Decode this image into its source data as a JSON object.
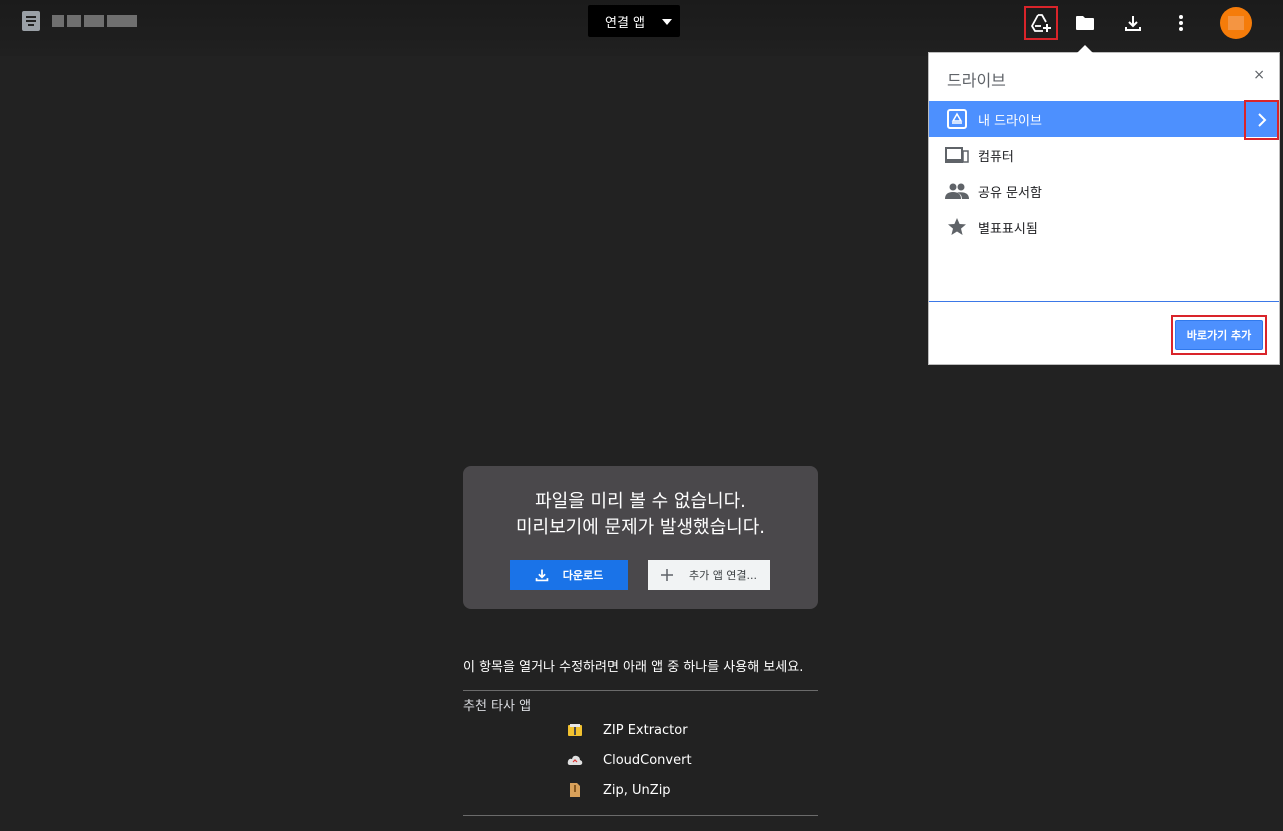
{
  "header": {
    "open_app_label": "연결 앱",
    "icons": [
      "add-shortcut-to-drive-icon",
      "folder-icon",
      "download-icon",
      "more-vert-icon"
    ]
  },
  "drive_panel": {
    "title": "드라이브",
    "close_label": "×",
    "items": [
      {
        "label": "내 드라이브",
        "icon": "my-drive-icon",
        "active": true
      },
      {
        "label": "컴퓨터",
        "icon": "computers-icon",
        "active": false
      },
      {
        "label": "공유 문서함",
        "icon": "shared-with-me-icon",
        "active": false
      },
      {
        "label": "별표표시됨",
        "icon": "star-icon",
        "active": false
      }
    ],
    "add_shortcut_label": "바로가기 추가"
  },
  "preview": {
    "message_line1": "파일을 미리 볼 수 없습니다.",
    "message_line2": "미리보기에 문제가 발생했습니다.",
    "download_label": "다운로드",
    "connect_apps_label": "추가 앱 연결..."
  },
  "suggestions": {
    "hint": "이 항목을 열거나 수정하려면 아래 앱 중 하나를 사용해 보세요.",
    "section_label": "추천 타사 앱",
    "apps": [
      "ZIP Extractor",
      "CloudConvert",
      "Zip, UnZip"
    ]
  },
  "colors": {
    "accent": "#4d90fe",
    "download_blue": "#1a73e8",
    "highlight_red": "#d9242a",
    "avatar": "#f57c0a"
  }
}
